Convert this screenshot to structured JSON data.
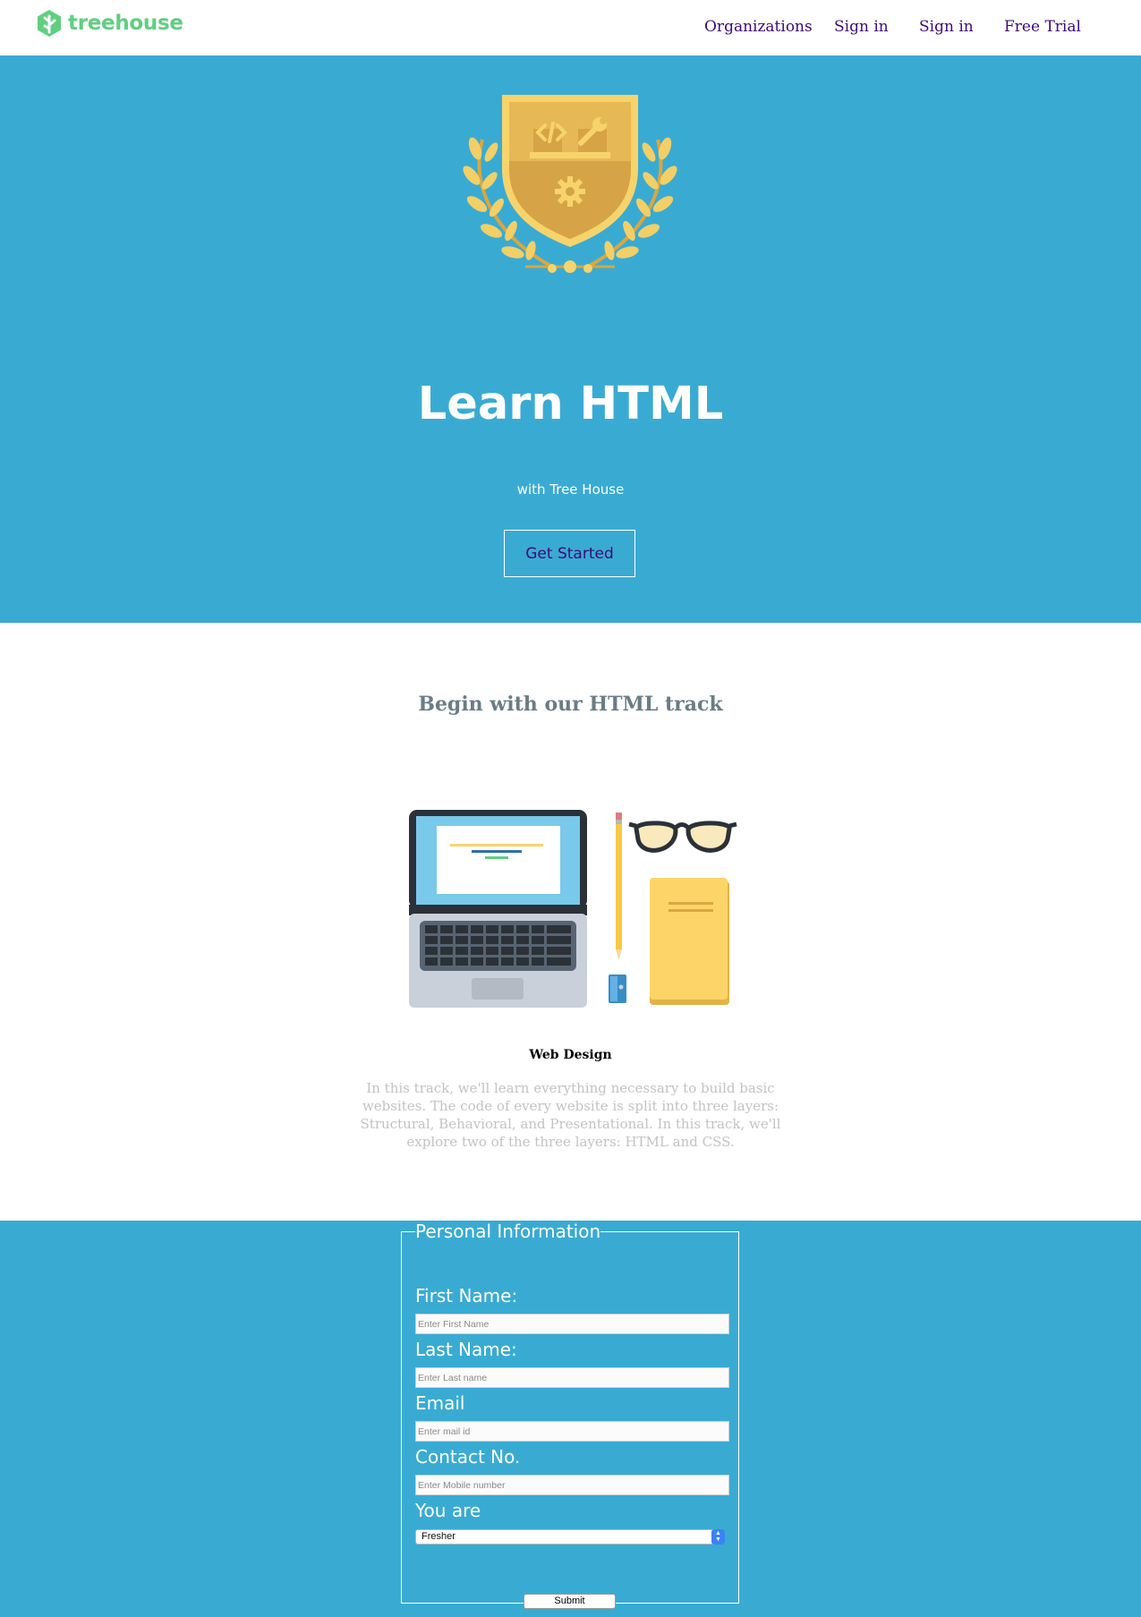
{
  "nav": {
    "logo_text": "treehouse",
    "links": [
      "Organizations",
      "Sign in",
      "Sign in",
      "Free Trial"
    ]
  },
  "hero": {
    "title": "Learn HTML",
    "subtitle": "with Tree House",
    "cta_label": "Get Started"
  },
  "track": {
    "heading": "Begin with our HTML track",
    "name": "Web Design",
    "description": "In this track, we'll learn everything necessary to build basic websites. The code of every website is split into three layers: Structural, Behavioral, and Presentational. In this track, we'll explore two of the three layers: HTML and CSS."
  },
  "form": {
    "legend": "Personal Information",
    "first_name": {
      "label": "First Name:",
      "placeholder": "Enter First Name"
    },
    "last_name": {
      "label": "Last Name:",
      "placeholder": "Enter Last name"
    },
    "email": {
      "label": "Email",
      "placeholder": "Enter mail id"
    },
    "contact": {
      "label": "Contact No.",
      "placeholder": "Enter Mobile number"
    },
    "role": {
      "label": "You are",
      "selected": "Fresher"
    },
    "submit_label": "Submit"
  },
  "colors": {
    "brand_green": "#5fcf80",
    "hero_blue": "#39abd3",
    "link_purple": "#3e0a78",
    "heading_gray": "#6a7d86",
    "desc_gray": "#c3c3c3"
  },
  "icons": [
    "treehouse-logo-icon",
    "shield-badge-icon",
    "laptop-icon",
    "pencil-icon",
    "glasses-icon",
    "notebook-icon"
  ]
}
